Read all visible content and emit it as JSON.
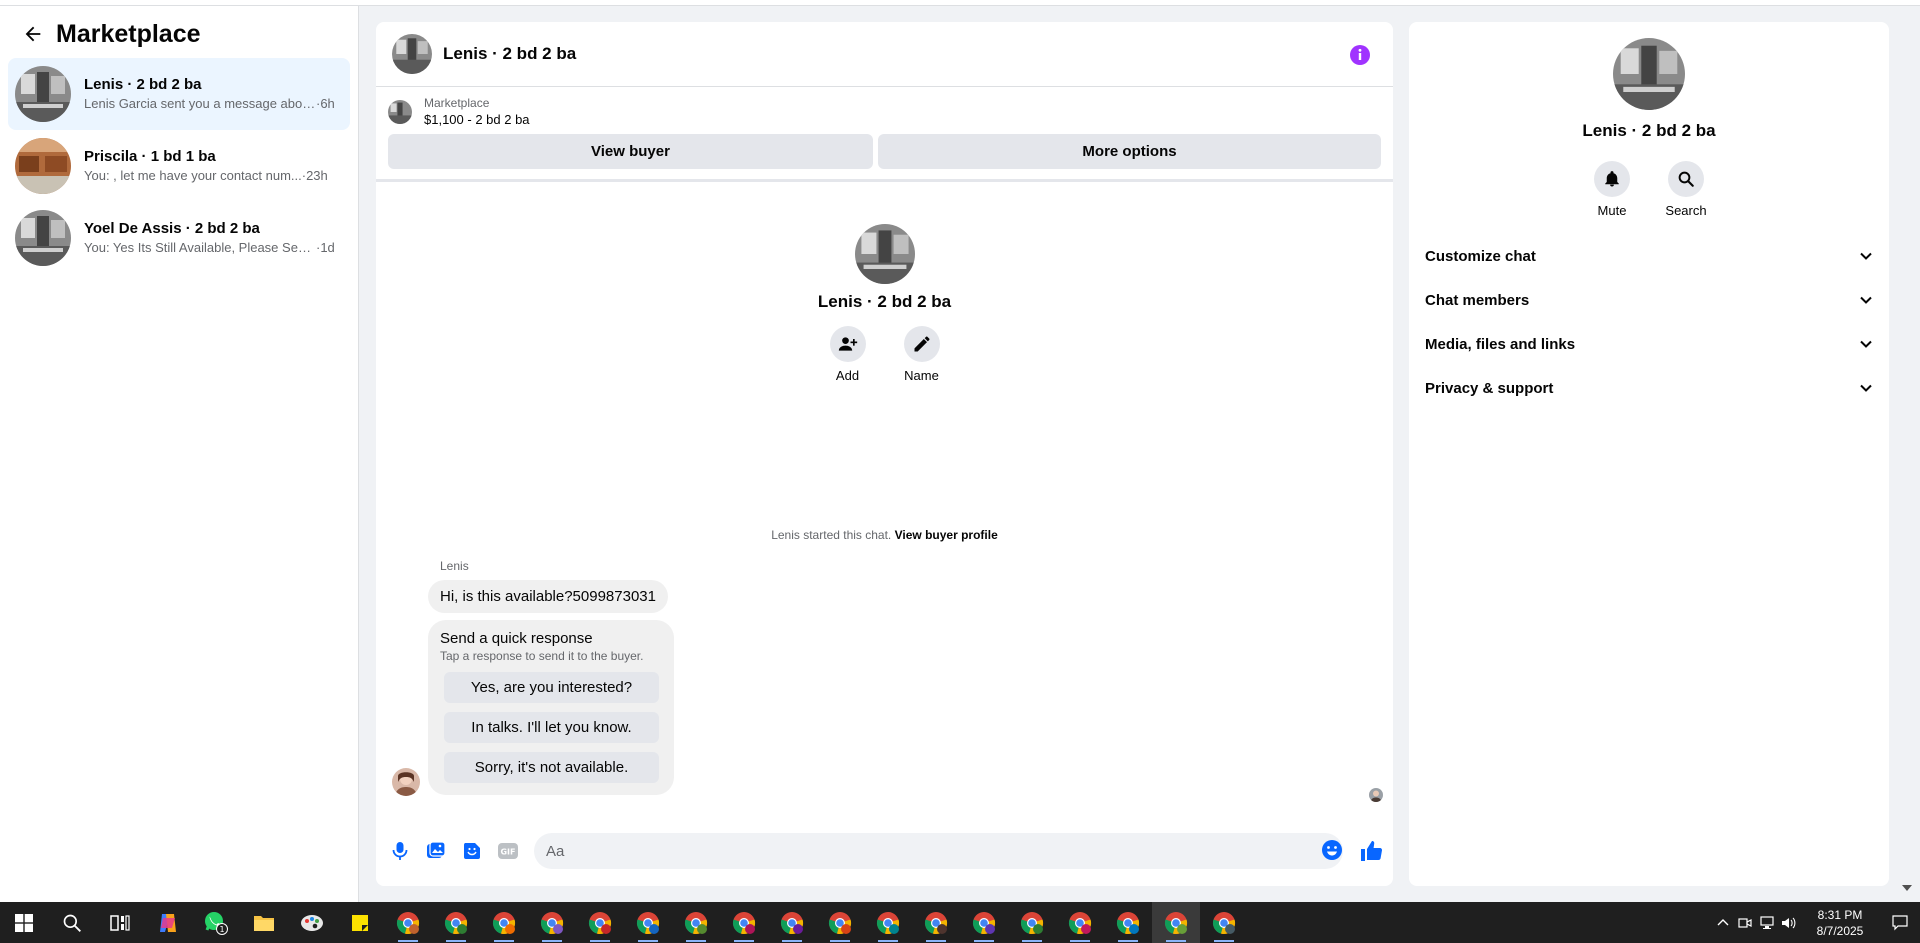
{
  "sidebar": {
    "title": "Marketplace",
    "conversations": [
      {
        "name": "Lenis · 2 bd 2 ba",
        "snippet": "Lenis Garcia sent you a message abou...",
        "time": "·6h",
        "active": true
      },
      {
        "name": "Priscila · 1 bd 1 ba",
        "snippet": "You: , let me have your contact num...",
        "time": "·23h",
        "active": false
      },
      {
        "name": "Yoel De Assis · 2 bd 2 ba",
        "snippet": "You: Yes Its Still Available, Please Send...",
        "time": "·1d",
        "active": false
      }
    ]
  },
  "chat": {
    "header_name": "Lenis · 2 bd 2 ba",
    "listing": {
      "source": "Marketplace",
      "price_line": "$1,100 - 2 bd 2 ba",
      "view_buyer": "View buyer",
      "more_options": "More options"
    },
    "intro": {
      "name": "Lenis · 2 bd 2 ba",
      "add_label": "Add",
      "name_label": "Name"
    },
    "started_text": "Lenis started this chat.",
    "started_link": "View buyer profile",
    "sender": "Lenis",
    "message": "Hi, is this available?5099873031",
    "quick": {
      "title": "Send a quick response",
      "subtitle": "Tap a response to send it to the buyer.",
      "options": [
        "Yes, are you interested?",
        "In talks. I'll let you know.",
        "Sorry, it's not available."
      ]
    },
    "composer": {
      "placeholder": "Aa"
    }
  },
  "info_panel": {
    "name": "Lenis · 2 bd 2 ba",
    "mute": "Mute",
    "search": "Search",
    "sections": [
      "Customize chat",
      "Chat members",
      "Media, files and links",
      "Privacy & support"
    ]
  },
  "taskbar": {
    "time": "8:31 PM",
    "date": "8/7/2025",
    "whatsapp_badge": "1"
  },
  "colors": {
    "accent": "#0866ff",
    "info": "#a033ff",
    "active_row": "#ebf5ff"
  }
}
